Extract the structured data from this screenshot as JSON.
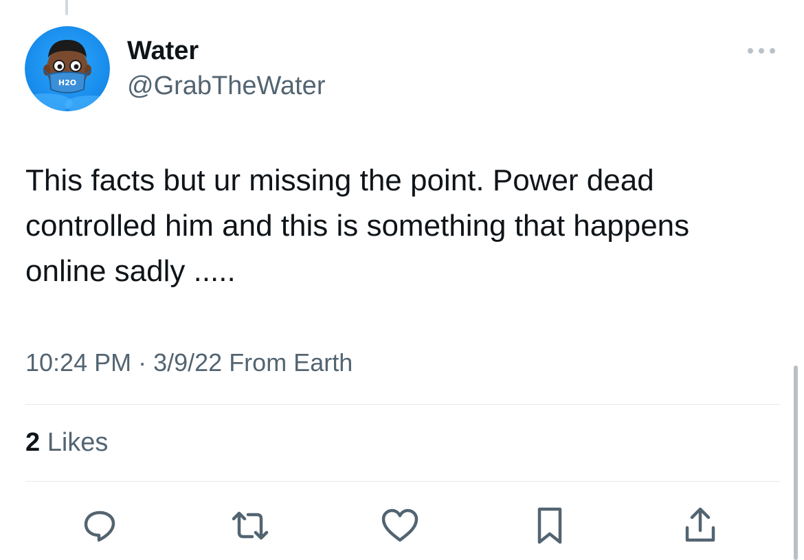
{
  "tweet": {
    "author": {
      "display_name": "Water",
      "handle": "@GrabTheWater",
      "avatar_text": "H2O"
    },
    "text": "This facts but ur missing the point. Power dead controlled him and this is something that happens online sadly .....",
    "time": "10:24 PM",
    "separator": " · ",
    "date": "3/9/22",
    "source": " From Earth",
    "likes_count": "2",
    "likes_label": " Likes"
  },
  "actions": {
    "reply_icon": "reply-icon",
    "retweet_icon": "retweet-icon",
    "like_icon": "heart-icon",
    "bookmark_icon": "bookmark-icon",
    "share_icon": "share-icon"
  },
  "colors": {
    "text_primary": "#0f1419",
    "text_secondary": "#536471",
    "divider": "#e7e9ea",
    "icon": "#536471",
    "avatar_bg": "#1d9bf0"
  }
}
